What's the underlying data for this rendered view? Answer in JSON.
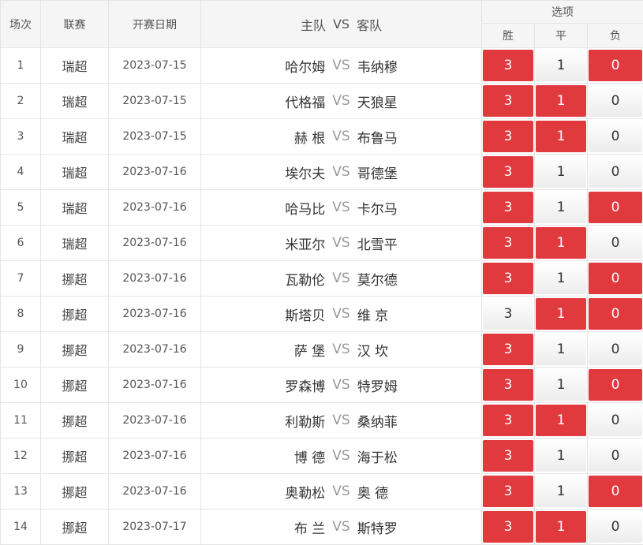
{
  "colors": {
    "selected": "#e0393e",
    "header_bg": "#f5f5f5",
    "border": "#e4e4e4"
  },
  "header": {
    "index": "场次",
    "league": "联赛",
    "date": "开赛日期",
    "home": "主队",
    "vs": "VS",
    "away": "客队",
    "options": "选项",
    "win": "胜",
    "draw": "平",
    "lose": "负"
  },
  "rows": [
    {
      "index": "1",
      "league": "瑞超",
      "date": "2023-07-15",
      "home": "哈尔姆",
      "vs": "VS",
      "away": "韦纳穆",
      "win": "3",
      "draw": "1",
      "lose": "0",
      "selected": {
        "win": true,
        "draw": false,
        "lose": true
      }
    },
    {
      "index": "2",
      "league": "瑞超",
      "date": "2023-07-15",
      "home": "代格福",
      "vs": "VS",
      "away": "天狼星",
      "win": "3",
      "draw": "1",
      "lose": "0",
      "selected": {
        "win": true,
        "draw": true,
        "lose": false
      }
    },
    {
      "index": "3",
      "league": "瑞超",
      "date": "2023-07-15",
      "home": "赫 根",
      "vs": "VS",
      "away": "布鲁马",
      "win": "3",
      "draw": "1",
      "lose": "0",
      "selected": {
        "win": true,
        "draw": true,
        "lose": false
      }
    },
    {
      "index": "4",
      "league": "瑞超",
      "date": "2023-07-16",
      "home": "埃尔夫",
      "vs": "VS",
      "away": "哥德堡",
      "win": "3",
      "draw": "1",
      "lose": "0",
      "selected": {
        "win": true,
        "draw": false,
        "lose": false
      }
    },
    {
      "index": "5",
      "league": "瑞超",
      "date": "2023-07-16",
      "home": "哈马比",
      "vs": "VS",
      "away": "卡尔马",
      "win": "3",
      "draw": "1",
      "lose": "0",
      "selected": {
        "win": true,
        "draw": false,
        "lose": true
      }
    },
    {
      "index": "6",
      "league": "瑞超",
      "date": "2023-07-16",
      "home": "米亚尔",
      "vs": "VS",
      "away": "北雪平",
      "win": "3",
      "draw": "1",
      "lose": "0",
      "selected": {
        "win": true,
        "draw": true,
        "lose": false
      }
    },
    {
      "index": "7",
      "league": "挪超",
      "date": "2023-07-16",
      "home": "瓦勒伦",
      "vs": "VS",
      "away": "莫尔德",
      "win": "3",
      "draw": "1",
      "lose": "0",
      "selected": {
        "win": true,
        "draw": false,
        "lose": true
      }
    },
    {
      "index": "8",
      "league": "挪超",
      "date": "2023-07-16",
      "home": "斯塔贝",
      "vs": "VS",
      "away": "维 京",
      "win": "3",
      "draw": "1",
      "lose": "0",
      "selected": {
        "win": false,
        "draw": true,
        "lose": true
      }
    },
    {
      "index": "9",
      "league": "挪超",
      "date": "2023-07-16",
      "home": "萨 堡",
      "vs": "VS",
      "away": "汉 坎",
      "win": "3",
      "draw": "1",
      "lose": "0",
      "selected": {
        "win": true,
        "draw": false,
        "lose": false
      }
    },
    {
      "index": "10",
      "league": "挪超",
      "date": "2023-07-16",
      "home": "罗森博",
      "vs": "VS",
      "away": "特罗姆",
      "win": "3",
      "draw": "1",
      "lose": "0",
      "selected": {
        "win": true,
        "draw": false,
        "lose": true
      }
    },
    {
      "index": "11",
      "league": "挪超",
      "date": "2023-07-16",
      "home": "利勒斯",
      "vs": "VS",
      "away": "桑纳菲",
      "win": "3",
      "draw": "1",
      "lose": "0",
      "selected": {
        "win": true,
        "draw": true,
        "lose": false
      }
    },
    {
      "index": "12",
      "league": "挪超",
      "date": "2023-07-16",
      "home": "博 德",
      "vs": "VS",
      "away": "海于松",
      "win": "3",
      "draw": "1",
      "lose": "0",
      "selected": {
        "win": true,
        "draw": false,
        "lose": false
      }
    },
    {
      "index": "13",
      "league": "挪超",
      "date": "2023-07-16",
      "home": "奥勒松",
      "vs": "VS",
      "away": "奥 德",
      "win": "3",
      "draw": "1",
      "lose": "0",
      "selected": {
        "win": true,
        "draw": false,
        "lose": true
      }
    },
    {
      "index": "14",
      "league": "挪超",
      "date": "2023-07-17",
      "home": "布 兰",
      "vs": "VS",
      "away": "斯特罗",
      "win": "3",
      "draw": "1",
      "lose": "0",
      "selected": {
        "win": true,
        "draw": true,
        "lose": false
      }
    }
  ]
}
